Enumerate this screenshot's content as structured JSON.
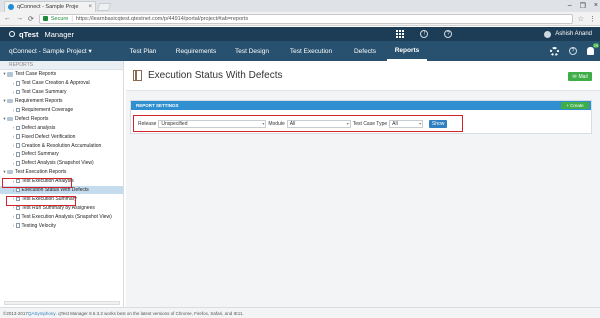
{
  "browser": {
    "tab_title": "qConnect - Sample Proje",
    "tab_close": "×",
    "window_user": "",
    "controls": [
      "–",
      "❐",
      "×"
    ],
    "secure_label": "Secure",
    "url": "https://learnbasicqtest.qtestnet.com/p/44914/portal/project#tab=reports"
  },
  "app": {
    "brand_bold": "qTest",
    "brand_product": "Manager",
    "badge_count": "29",
    "user_name": "Ashish Anand"
  },
  "nav": {
    "project_label": "qConnect - Sample Project ▾",
    "tabs": [
      "Test Plan",
      "Requirements",
      "Test Design",
      "Test Execution",
      "Defects",
      "Reports"
    ],
    "active_tab": "Reports"
  },
  "sidebar": {
    "header": "REPORTS",
    "groups": [
      {
        "label": "Test Case Reports",
        "items": [
          "Test Case Creation & Approval",
          "Test Case Summary"
        ]
      },
      {
        "label": "Requirement Reports",
        "items": [
          "Requirement Coverage"
        ]
      },
      {
        "label": "Defect Reports",
        "items": [
          "Defect analysis",
          "Fixed Defect Verification",
          "Creation & Resolution Accumulation",
          "Defect Summary",
          "Defect Analysis (Snapshot View)"
        ]
      },
      {
        "label": "Test Execution Reports",
        "items": [
          "Test Execution Analysis",
          "Execution Status With Defects",
          "Test Execution Summary",
          "Test Run Summary by Assignees",
          "Test Execution Analysis (Snapshot View)",
          "Testing Velocity"
        ]
      }
    ],
    "selected_item": "Execution Status With Defects"
  },
  "main": {
    "title": "Execution Status With Defects",
    "mail_label": "Mail",
    "settings_title": "REPORT SETTINGS",
    "create_label": "+ Create",
    "filters": {
      "release_label": "Release",
      "release_value": "Unspecified",
      "module_label": "Module",
      "module_value": "All",
      "type_label": "Test Case Type",
      "type_value": "All",
      "show_label": "Show"
    }
  },
  "footer": {
    "prefix": "©2013-2017 ",
    "company": "QASymphony",
    "suffix": ". qTest Manager 8.6.3.2 works best on the latest versions of Chrome, Firefox, Safari, and IE11."
  },
  "colors": {
    "header_bg": "#1d3d56",
    "nav_bg": "#27516f",
    "accent_blue": "#2f8fd0",
    "accent_green": "#3fae49",
    "highlight_red": "#d2232a"
  }
}
